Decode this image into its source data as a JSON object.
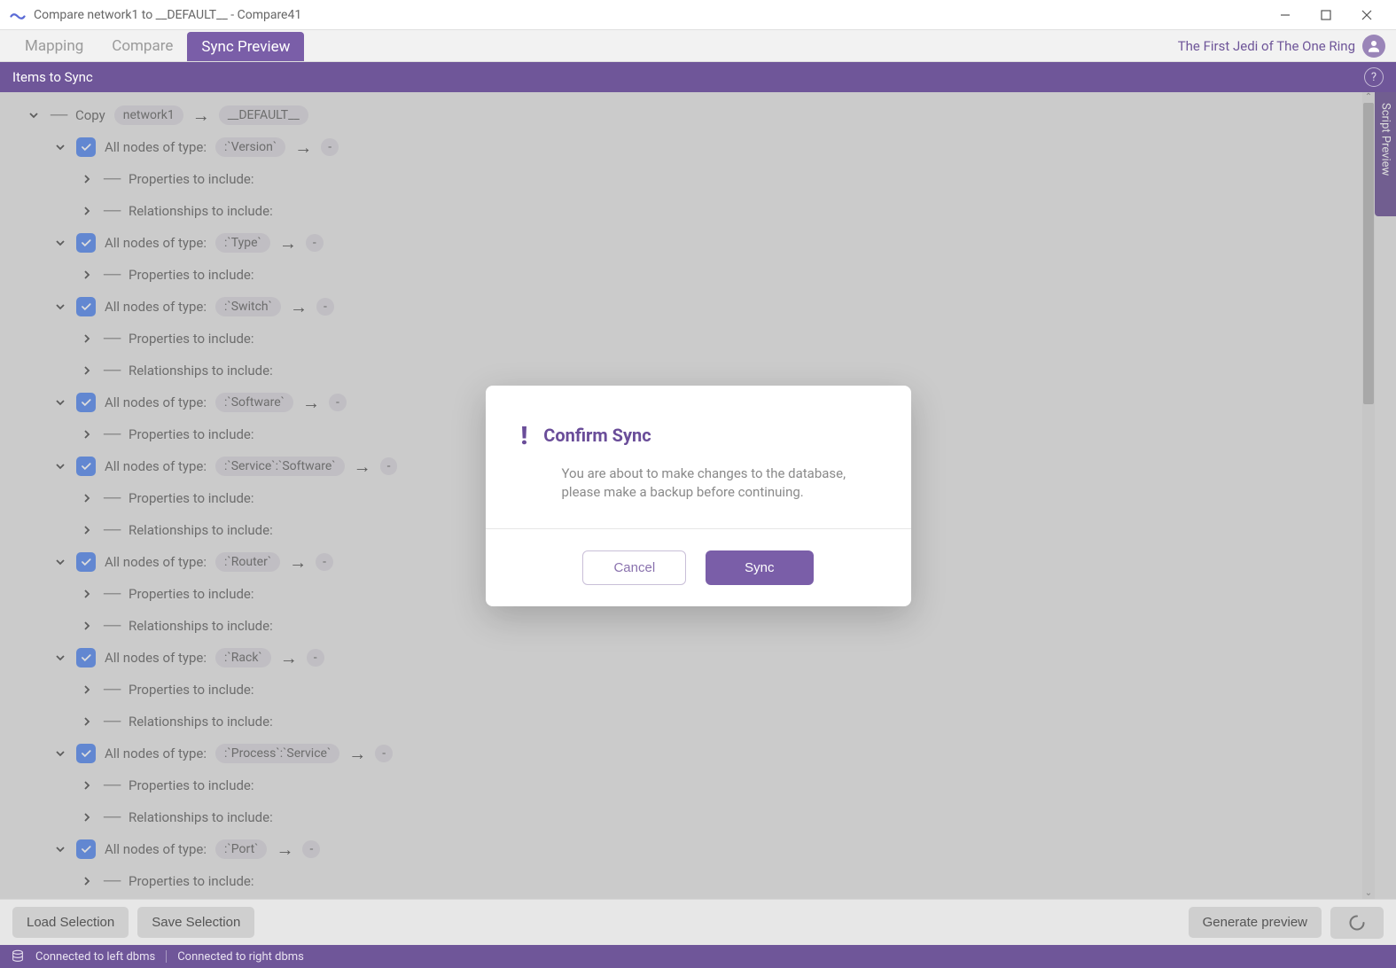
{
  "titlebar": {
    "title": "Compare network1 to __DEFAULT__ - Compare41"
  },
  "nav": {
    "tabs": [
      "Mapping",
      "Compare",
      "Sync Preview"
    ],
    "active_index": 2,
    "user": "The First Jedi of The One Ring"
  },
  "section": {
    "title": "Items to Sync"
  },
  "script_preview_tab": "Script Preview",
  "tree": {
    "copy_label": "Copy",
    "source": "network1",
    "target": "__DEFAULT__",
    "all_nodes_prefix": "All nodes of type:",
    "props_label": "Properties to include:",
    "rels_label": "Relationships to include:",
    "nodes": [
      {
        "type": ":`Version`",
        "children": [
          "props",
          "rels"
        ]
      },
      {
        "type": ":`Type`",
        "children": [
          "props"
        ]
      },
      {
        "type": ":`Switch`",
        "children": [
          "props",
          "rels"
        ]
      },
      {
        "type": ":`Software`",
        "children": [
          "props"
        ]
      },
      {
        "type": ":`Service`:`Software`",
        "children": [
          "props",
          "rels"
        ]
      },
      {
        "type": ":`Router`",
        "children": [
          "props",
          "rels"
        ]
      },
      {
        "type": ":`Rack`",
        "children": [
          "props",
          "rels"
        ]
      },
      {
        "type": ":`Process`:`Service`",
        "children": [
          "props",
          "rels"
        ]
      },
      {
        "type": ":`Port`",
        "children": [
          "props"
        ]
      }
    ]
  },
  "actions": {
    "load": "Load Selection",
    "save": "Save Selection",
    "generate": "Generate preview"
  },
  "status": {
    "left": "Connected to left dbms",
    "right": "Connected to right dbms"
  },
  "modal": {
    "title": "Confirm Sync",
    "text": "You are about to make changes to the database, please make a backup before continuing.",
    "cancel": "Cancel",
    "sync": "Sync"
  }
}
